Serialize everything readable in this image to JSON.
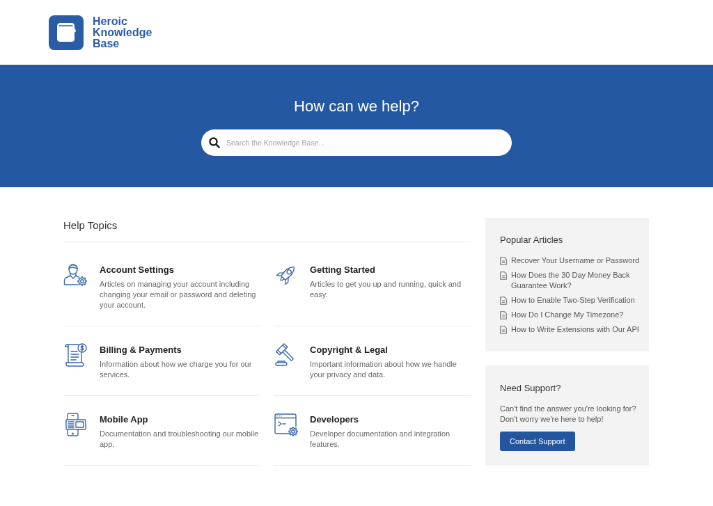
{
  "header": {
    "logo_text": "Heroic Knowledge Base"
  },
  "hero": {
    "title": "How can we help?",
    "search": {
      "placeholder": "Search the Knowledge Base..."
    }
  },
  "help_topics": {
    "title": "Help Topics",
    "topics": [
      {
        "title": "Account Settings",
        "description": "Articles on managing your account including changing your email or password and deleting your account."
      },
      {
        "title": "Getting Started",
        "description": "Articles to get you up and running, quick and easy."
      },
      {
        "title": "Billing & Payments",
        "description": "Information about how we charge you for our services."
      },
      {
        "title": "Copyright & Legal",
        "description": "Important information about how we handle your privacy and data."
      },
      {
        "title": "Mobile App",
        "description": "Documentation and troubleshooting our mobile app."
      },
      {
        "title": "Developers",
        "description": "Developer documentation and integration features."
      }
    ]
  },
  "popular_articles": {
    "title": "Popular Articles",
    "articles": [
      "Recover Your Username or Password",
      "How Does the 30 Day Money Back Guarantee Work?",
      "How to Enable Two-Step Verification",
      "How Do I Change My Timezone?",
      "How to Write Extensions with Our API"
    ]
  },
  "support": {
    "title": "Need Support?",
    "text": "Can't find the answer you're looking for? Don't worry we're here to help!",
    "button": "Contact Support"
  }
}
